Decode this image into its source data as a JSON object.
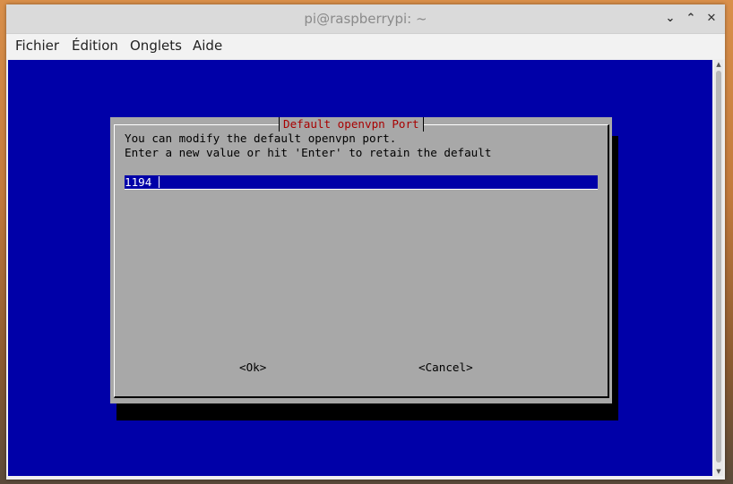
{
  "window": {
    "title": "pi@raspberrypi: ~",
    "controls": {
      "minimize": "⌄",
      "maximize": "⌃",
      "close": "✕"
    }
  },
  "menu": {
    "items": [
      "Fichier",
      "Édition",
      "Onglets",
      "Aide"
    ]
  },
  "dialog": {
    "title": "Default openvpn Port",
    "line1": "You can modify the default openvpn port.",
    "line2": "Enter a new value or hit 'Enter' to retain the default",
    "input_value": "1194",
    "ok_label": "<Ok>",
    "cancel_label": "<Cancel>"
  },
  "colors": {
    "terminal_bg": "#0000a8",
    "dialog_bg": "#a8a8a8",
    "dialog_title": "#a80000"
  }
}
